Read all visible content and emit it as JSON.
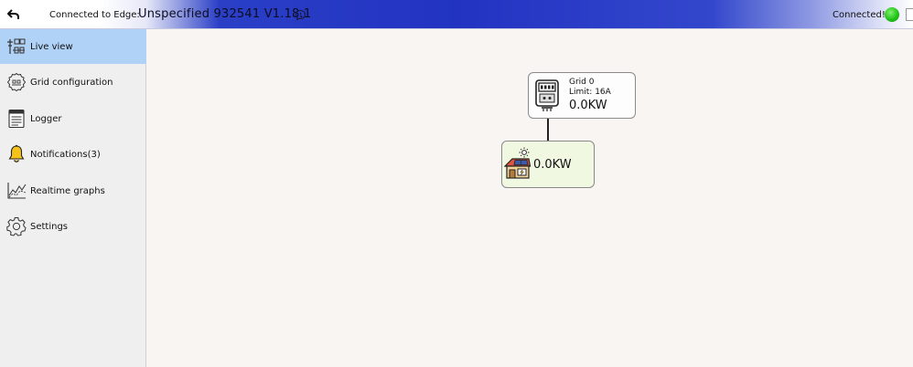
{
  "header": {
    "connected_label": "Connected to Edge:",
    "device_name": "Unspecified 932541",
    "version": "V1.18.1",
    "status": "Connected!",
    "status_color": "#22c21a"
  },
  "sidebar": {
    "items": [
      {
        "label": "Live view",
        "icon": "live-view-icon",
        "active": true
      },
      {
        "label": "Grid configuration",
        "icon": "grid-config-icon",
        "active": false
      },
      {
        "label": "Logger",
        "icon": "logger-icon",
        "active": false
      },
      {
        "label": "Notifications(3)",
        "icon": "bell-icon",
        "active": false
      },
      {
        "label": "Realtime graphs",
        "icon": "graph-icon",
        "active": false
      },
      {
        "label": "Settings",
        "icon": "gear-icon",
        "active": false
      }
    ]
  },
  "live_view": {
    "grid": {
      "title": "Grid 0",
      "limit": "Limit: 16A",
      "power": "0.0KW",
      "icon": "electric-meter-icon"
    },
    "house": {
      "power": "0.0KW",
      "icon": "solar-house-icon"
    }
  }
}
